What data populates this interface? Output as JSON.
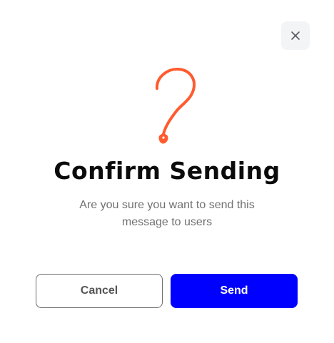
{
  "dialog": {
    "title": "Confirm Sending",
    "message": "Are you sure you want to send this message to users",
    "cancel_label": "Cancel",
    "send_label": "Send",
    "icons": {
      "close": "close-icon",
      "illustration": "question-mark-icon"
    },
    "colors": {
      "accent": "#0000ff",
      "illustration": "#ff5b2e",
      "close_bg": "#f3f4f6",
      "title": "#0b0b0b",
      "message": "#707070"
    }
  }
}
